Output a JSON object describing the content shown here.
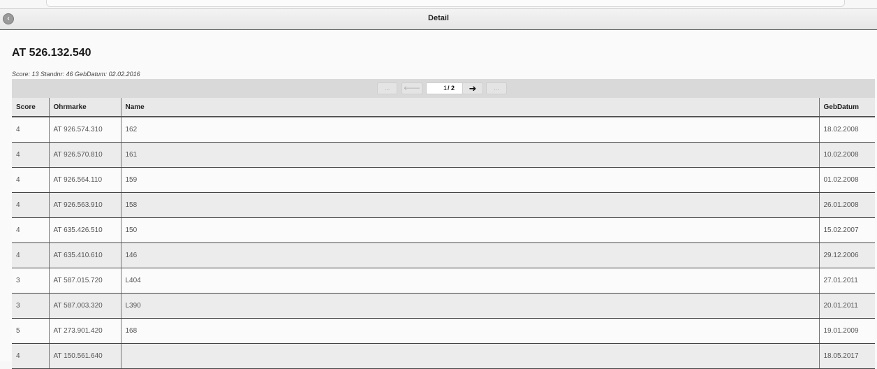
{
  "header": {
    "title": "Detail",
    "back_icon": "back-circle-icon"
  },
  "animal": {
    "ohrmarke": "AT 526.132.540",
    "subtitle": "Score: 13 Standnr: 46 GebDatum: 02.02.2016"
  },
  "pager": {
    "first": "...",
    "prev_icon": "arrow-left-icon",
    "current": "1",
    "total": "/ 2",
    "next_icon": "arrow-right-icon",
    "last": "...",
    "prev_glyph": "🡐",
    "next_glyph": "➜"
  },
  "table": {
    "columns": [
      "Score",
      "Ohrmarke",
      "Name",
      "GebDatum"
    ],
    "rows": [
      [
        "4",
        "AT 926.574.310",
        "162",
        "18.02.2008"
      ],
      [
        "4",
        "AT 926.570.810",
        "161",
        "10.02.2008"
      ],
      [
        "4",
        "AT 926.564.110",
        "159",
        "01.02.2008"
      ],
      [
        "4",
        "AT 926.563.910",
        "158",
        "26.01.2008"
      ],
      [
        "4",
        "AT 635.426.510",
        "150",
        "15.02.2007"
      ],
      [
        "4",
        "AT 635.410.610",
        "146",
        "29.12.2006"
      ],
      [
        "3",
        "AT 587.015.720",
        "L404",
        "27.01.2011"
      ],
      [
        "3",
        "AT 587.003.320",
        "L390",
        "20.01.2011"
      ],
      [
        "5",
        "AT 273.901.420",
        "168",
        "19.01.2009"
      ],
      [
        "4",
        "AT 150.561.640",
        "",
        "18.05.2017"
      ]
    ]
  }
}
